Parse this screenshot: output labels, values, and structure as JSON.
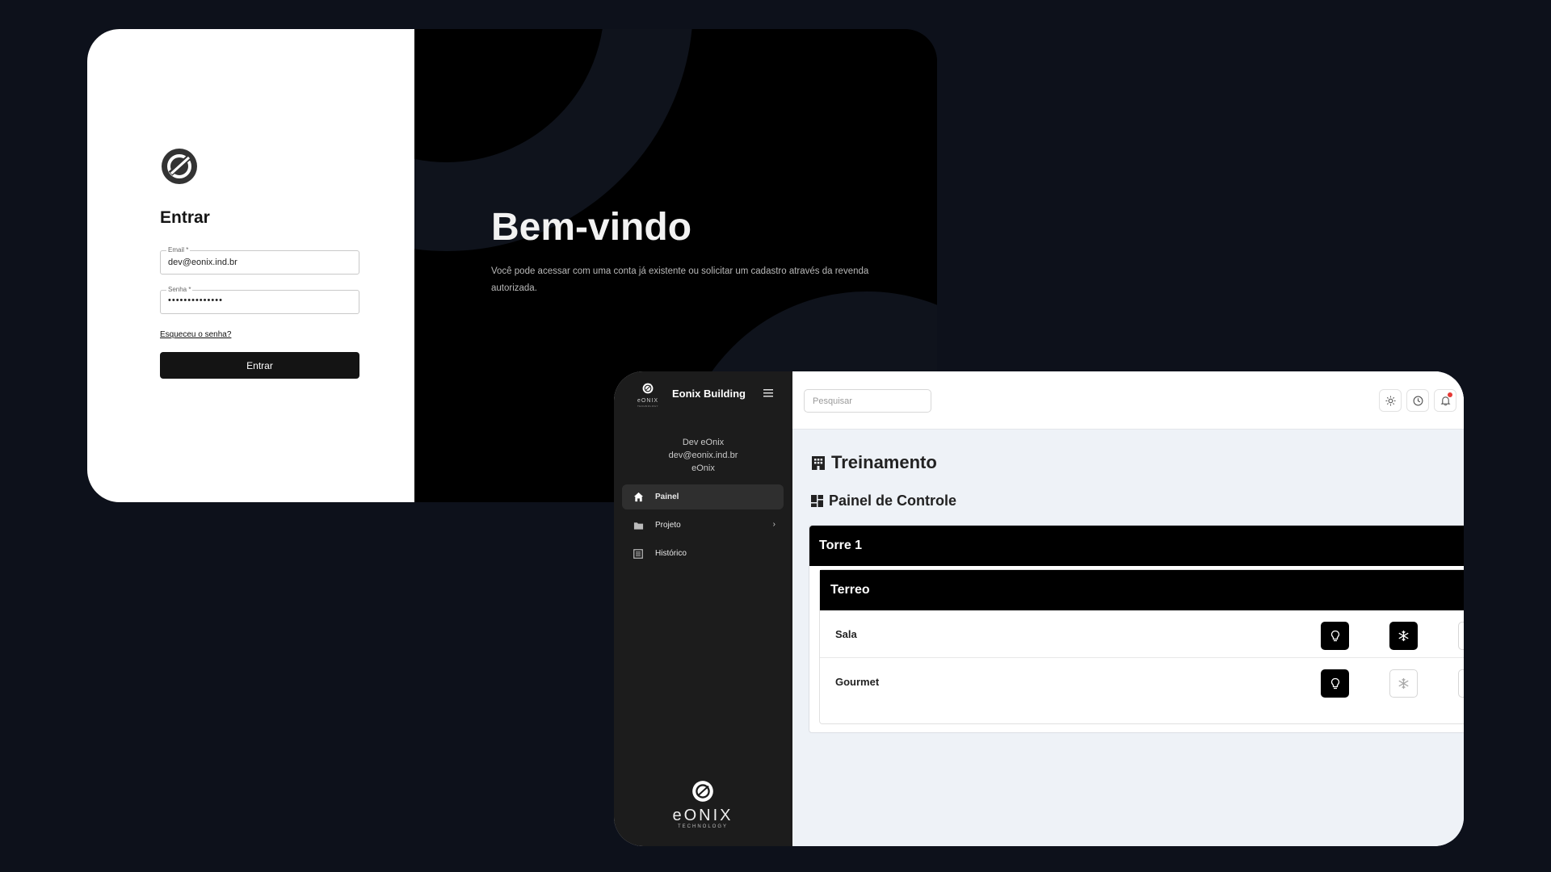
{
  "login": {
    "title": "Entrar",
    "email_label": "Email *",
    "email_value": "dev@eonix.ind.br",
    "password_label": "Senha *",
    "password_masked": "••••••••••••••",
    "forgot_link": "Esqueceu o senha?",
    "submit_label": "Entrar",
    "welcome_title": "Bem-vindo",
    "welcome_text": "Você pode acessar com uma conta já existente ou solicitar um cadastro através da revenda autorizada."
  },
  "dashboard": {
    "app_title": "Eonix Building",
    "logo_small_text": "eONIX",
    "logo_small_sub": "TECHNOLOGY",
    "user": {
      "name": "Dev eOnix",
      "email": "dev@eonix.ind.br",
      "company": "eOnix"
    },
    "nav": [
      {
        "label": "Painel",
        "icon": "home-icon",
        "active": true
      },
      {
        "label": "Projeto",
        "icon": "folder-icon",
        "has_submenu": true
      },
      {
        "label": "Histórico",
        "icon": "list-icon"
      }
    ],
    "bottom_logo_text": "eONIX",
    "bottom_logo_sub": "TECHNOLOGY",
    "search_placeholder": "Pesquisar",
    "toolbar_icons": [
      "sun-icon",
      "clock-icon",
      "bell-icon"
    ],
    "page_title": "Treinamento",
    "section_title": "Painel de Controle",
    "tower": "Torre 1",
    "floor": "Terreo",
    "rooms": [
      {
        "name": "Sala",
        "light": "on",
        "ac": "on"
      },
      {
        "name": "Gourmet",
        "light": "on",
        "ac": "off"
      }
    ]
  },
  "colors": {
    "page_bg": "#0d111b",
    "sidebar_bg": "#1c1c1c",
    "header_black": "#000000",
    "notification": "#e53935"
  }
}
